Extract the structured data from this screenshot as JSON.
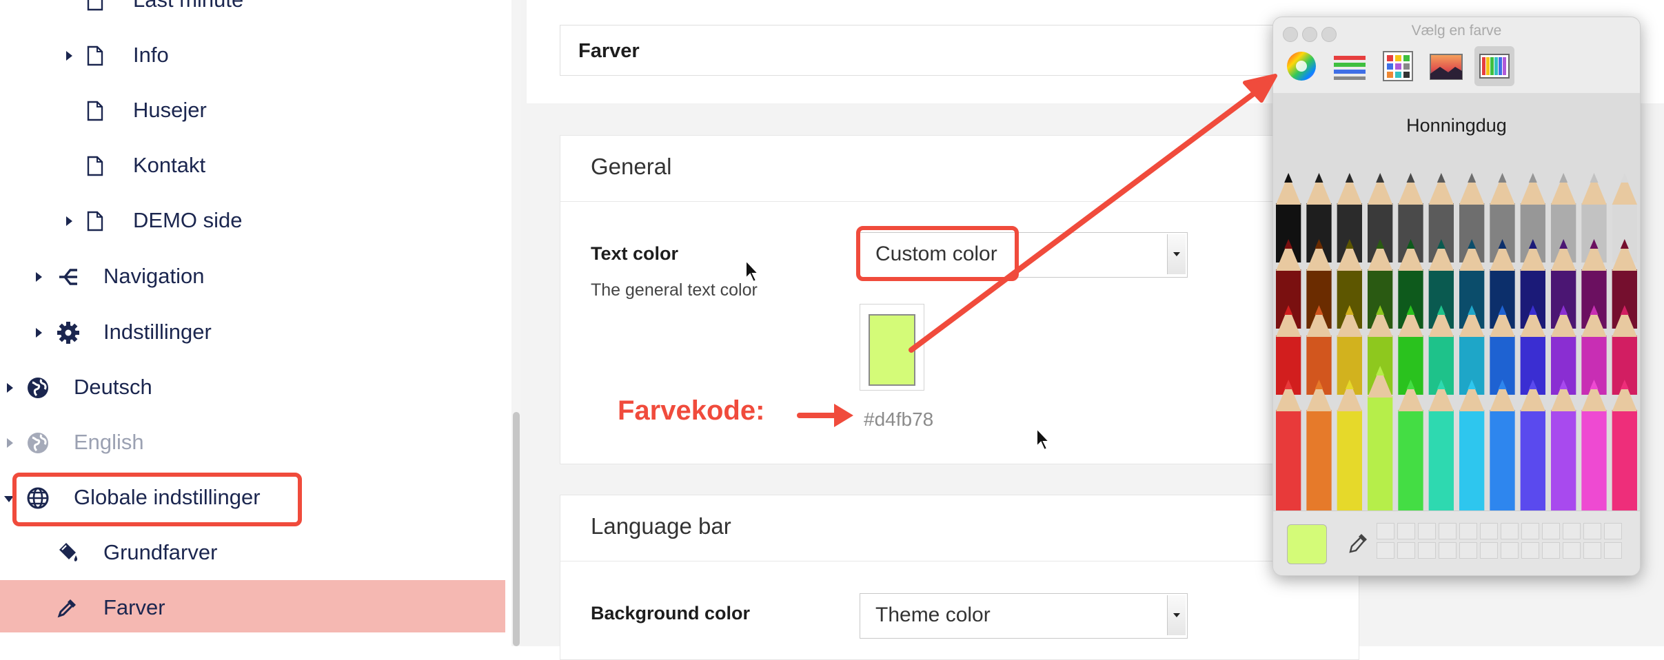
{
  "sidebar": {
    "items": [
      {
        "label": "Last minute",
        "icon": "page-icon"
      },
      {
        "label": "Info",
        "icon": "page-icon"
      },
      {
        "label": "Husejer",
        "icon": "page-icon"
      },
      {
        "label": "Kontakt",
        "icon": "page-icon"
      },
      {
        "label": "DEMO side",
        "icon": "page-icon"
      },
      {
        "label": "Navigation",
        "icon": "navigation-icon"
      },
      {
        "label": "Indstillinger",
        "icon": "gear-icon"
      },
      {
        "label": "Deutsch",
        "icon": "globe-icon"
      },
      {
        "label": "English",
        "icon": "globe-icon"
      },
      {
        "label": "Globale indstillinger",
        "icon": "globe-icon"
      },
      {
        "label": "Grundfarver",
        "icon": "paint-bucket-icon"
      },
      {
        "label": "Farver",
        "icon": "eyedropper-icon"
      }
    ],
    "active_item": "Farver",
    "active_color": "#f5b8b2"
  },
  "main": {
    "title": "Farver",
    "general": {
      "heading": "General",
      "text_color_label": "Text color",
      "text_color_desc": "The general text color",
      "text_color_select": "Custom color",
      "swatch_color": "#d4fb78",
      "hex_value": "#d4fb78"
    },
    "language_bar": {
      "heading": "Language bar",
      "bg_label": "Background color",
      "bg_select": "Theme color"
    }
  },
  "annotation": {
    "label": "Farvekode:",
    "color": "#f04b3c"
  },
  "color_picker": {
    "window_title": "Vælg en farve",
    "selected_palette": "Honningdug",
    "tabs": [
      "color-wheel-icon",
      "sliders-icon",
      "palettes-icon",
      "image-palette-icon",
      "pencils-icon"
    ],
    "current_color": "#d4fb78"
  }
}
